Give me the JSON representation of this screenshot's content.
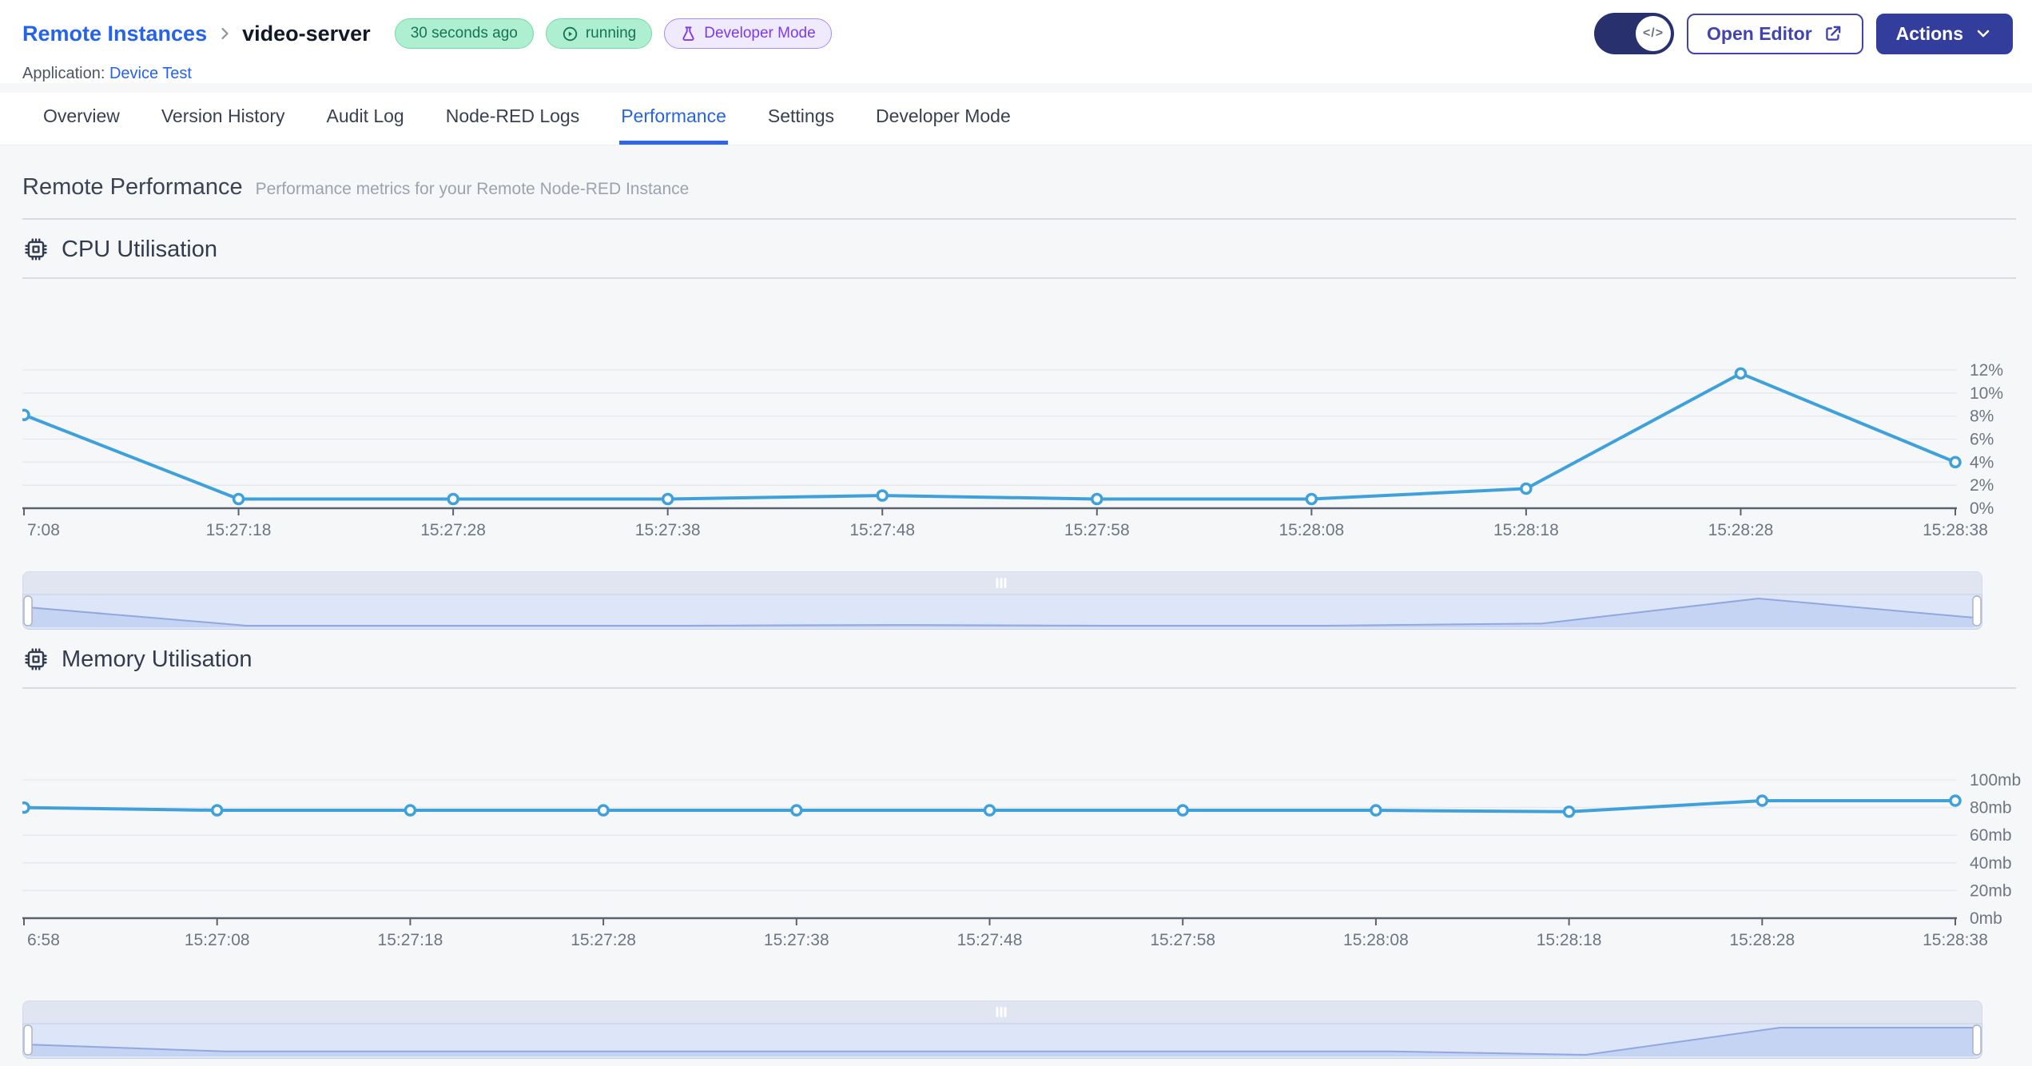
{
  "header": {
    "breadcrumb": {
      "parent": "Remote Instances",
      "current": "video-server"
    },
    "badges": {
      "last_seen": "30 seconds ago",
      "status": "running",
      "mode": "Developer Mode"
    },
    "application": {
      "label": "Application:",
      "name": "Device Test"
    },
    "controls": {
      "code_toggle_glyph": "</>",
      "open_editor_label": "Open Editor",
      "actions_label": "Actions"
    }
  },
  "tabs": {
    "items": [
      {
        "label": "Overview",
        "active": false
      },
      {
        "label": "Version History",
        "active": false
      },
      {
        "label": "Audit Log",
        "active": false
      },
      {
        "label": "Node-RED Logs",
        "active": false
      },
      {
        "label": "Performance",
        "active": true
      },
      {
        "label": "Settings",
        "active": false
      },
      {
        "label": "Developer Mode",
        "active": false
      }
    ]
  },
  "page": {
    "title": "Remote Performance",
    "subtitle": "Performance metrics for your Remote Node-RED Instance"
  },
  "sections": {
    "cpu": {
      "title": "CPU Utilisation"
    },
    "memory": {
      "title": "Memory Utilisation"
    }
  },
  "colors": {
    "line": "#3EA1DB",
    "grid": "#E7EBF1",
    "axis": "#5A6270",
    "axis_text": "#6E7683",
    "accent_blue": "#2563EB",
    "brush_bg": "#DCE6F8",
    "brush_bar": "#E1E5F2",
    "brush_fill": "#C5D4F3",
    "brush_line": "#90A7E2",
    "brush_border": "#C7D0E2",
    "handle_border": "#A8B0BF"
  },
  "chart_data": [
    {
      "id": "cpu",
      "type": "line",
      "title": "CPU Utilisation",
      "x": [
        "7:08",
        "15:27:18",
        "15:27:28",
        "15:27:38",
        "15:27:48",
        "15:27:58",
        "15:28:08",
        "15:28:18",
        "15:28:28",
        "15:28:38"
      ],
      "values": [
        8.1,
        0.8,
        0.8,
        0.8,
        1.1,
        0.8,
        0.8,
        1.7,
        11.7,
        4.0
      ],
      "yticks": [
        0,
        2,
        4,
        6,
        8,
        10,
        12
      ],
      "y_suffix": "%",
      "ylim": [
        0,
        12
      ],
      "grid": true,
      "legend": "none"
    },
    {
      "id": "memory",
      "type": "line",
      "title": "Memory Utilisation",
      "x": [
        "6:58",
        "15:27:08",
        "15:27:18",
        "15:27:28",
        "15:27:38",
        "15:27:48",
        "15:27:58",
        "15:28:08",
        "15:28:18",
        "15:28:28",
        "15:28:38"
      ],
      "values": [
        80,
        78,
        78,
        78,
        78,
        78,
        78,
        78,
        77,
        85,
        85
      ],
      "yticks": [
        0,
        20,
        40,
        60,
        80,
        100
      ],
      "y_suffix": "mb",
      "ylim": [
        0,
        100
      ],
      "grid": true,
      "legend": "none"
    }
  ]
}
